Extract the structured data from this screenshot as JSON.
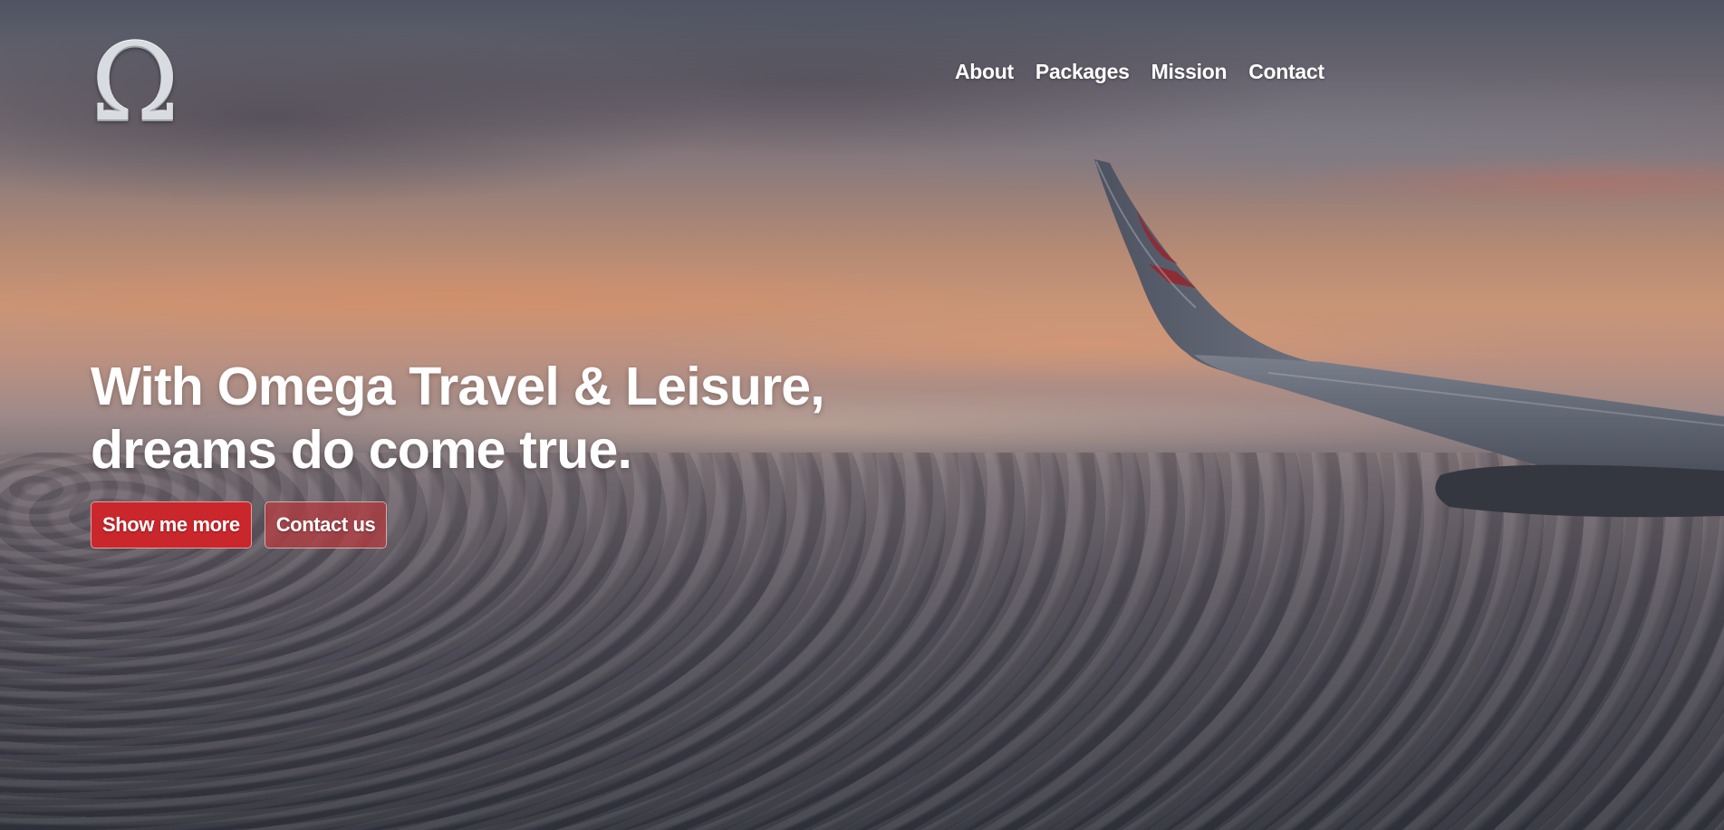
{
  "brand": {
    "logo_icon": "omega-logo-icon",
    "logo_glyph": "Ω"
  },
  "nav": {
    "items": [
      {
        "label": "About"
      },
      {
        "label": "Packages"
      },
      {
        "label": "Mission"
      },
      {
        "label": "Contact"
      }
    ]
  },
  "hero": {
    "headline_line1": "With Omega Travel & Leisure,",
    "headline_line2": "dreams do come true.",
    "primary_button": "Show me more",
    "secondary_button": "Contact us",
    "background": "airplane-wing-over-clouds-at-sunset"
  },
  "colors": {
    "button_primary": "#c9272c",
    "button_secondary": "#b43c40",
    "text": "#ffffff"
  }
}
